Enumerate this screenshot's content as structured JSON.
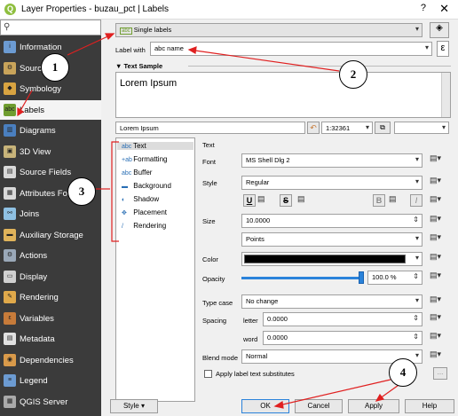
{
  "window": {
    "title": "Layer Properties - buzau_pct | Labels",
    "help": "?",
    "close": "✕"
  },
  "sidebar": {
    "items": [
      {
        "label": "Information",
        "icon": "info-icon",
        "color": "#6c9bd2",
        "glyph": "i"
      },
      {
        "label": "Source",
        "icon": "wrench-icon",
        "color": "#c9a45a",
        "glyph": "⚙"
      },
      {
        "label": "Symbology",
        "icon": "symbology-icon",
        "color": "#d9a441",
        "glyph": "◆"
      },
      {
        "label": "Labels",
        "icon": "abc-labels-icon",
        "color": "#6f9d2f",
        "glyph": "abc"
      },
      {
        "label": "Diagrams",
        "icon": "diagram-icon",
        "color": "#4a7fbf",
        "glyph": "▥"
      },
      {
        "label": "3D View",
        "icon": "cube-icon",
        "color": "#c8b47a",
        "glyph": "▣"
      },
      {
        "label": "Source Fields",
        "icon": "fields-icon",
        "color": "#d9d9d9",
        "glyph": "▤"
      },
      {
        "label": "Attributes Fo",
        "icon": "form-icon",
        "color": "#d9d9d9",
        "glyph": "▦"
      },
      {
        "label": "Joins",
        "icon": "joins-icon",
        "color": "#8fc1e3",
        "glyph": "⚯"
      },
      {
        "label": "Auxiliary Storage",
        "icon": "storage-icon",
        "color": "#e0b35a",
        "glyph": "▬"
      },
      {
        "label": "Actions",
        "icon": "gear-icon",
        "color": "#9aa8b8",
        "glyph": "⚙"
      },
      {
        "label": "Display",
        "icon": "speech-icon",
        "color": "#d0d0d0",
        "glyph": "▭"
      },
      {
        "label": "Rendering",
        "icon": "brush-icon",
        "color": "#e0a94a",
        "glyph": "✎"
      },
      {
        "label": "Variables",
        "icon": "variables-icon",
        "color": "#c77b3a",
        "glyph": "ε"
      },
      {
        "label": "Metadata",
        "icon": "metadata-icon",
        "color": "#e0e0e0",
        "glyph": "▤"
      },
      {
        "label": "Dependencies",
        "icon": "dependencies-icon",
        "color": "#d99a4a",
        "glyph": "◉"
      },
      {
        "label": "Legend",
        "icon": "legend-icon",
        "color": "#6c9bd2",
        "glyph": "≡"
      },
      {
        "label": "QGIS Server",
        "icon": "server-icon",
        "color": "#aaaaaa",
        "glyph": "▦"
      }
    ]
  },
  "labels": {
    "mode": "Single labels",
    "label_with_caption": "Label with",
    "label_with_value": "abc name",
    "expression_btn": "ε",
    "text_sample_header": "Text Sample",
    "sample_text": "Lorem Ipsum",
    "sample_input": "Lorem Ipsum",
    "scale": "1:32361",
    "tabs": [
      {
        "label": "Text",
        "icon": "text-icon",
        "glyph": "abc"
      },
      {
        "label": "Formatting",
        "icon": "formatting-icon",
        "glyph": "+ab"
      },
      {
        "label": "Buffer",
        "icon": "buffer-icon",
        "glyph": "abc"
      },
      {
        "label": "Background",
        "icon": "background-icon",
        "glyph": "▬"
      },
      {
        "label": "Shadow",
        "icon": "shadow-icon",
        "glyph": "◐"
      },
      {
        "label": "Placement",
        "icon": "placement-icon",
        "glyph": "✥"
      },
      {
        "label": "Rendering",
        "icon": "rendering-icon",
        "glyph": "/"
      }
    ],
    "text_section": "Text",
    "font_label": "Font",
    "font_value": "MS Shell Dlg 2",
    "style_label": "Style",
    "style_value": "Regular",
    "size_label": "Size",
    "size_value": "10.0000",
    "size_unit": "Points",
    "color_label": "Color",
    "color_value": "#000000",
    "opacity_label": "Opacity",
    "opacity_value": "100.0 %",
    "typecase_label": "Type case",
    "typecase_value": "No change",
    "spacing_label": "Spacing",
    "letter_label": "letter",
    "letter_value": "0.0000",
    "word_label": "word",
    "word_value": "0.0000",
    "blend_label": "Blend mode",
    "blend_value": "Normal",
    "substitutes_label": "Apply label text substitutes",
    "more_btn": "..."
  },
  "buttons": {
    "style": "Style",
    "ok": "OK",
    "cancel": "Cancel",
    "apply": "Apply",
    "help": "Help"
  },
  "annotations": [
    "1",
    "2",
    "3",
    "4"
  ],
  "colors": {
    "annotation": "#e02020",
    "sidebar": "#3b3b3b",
    "selected": "#f4f4f4"
  }
}
